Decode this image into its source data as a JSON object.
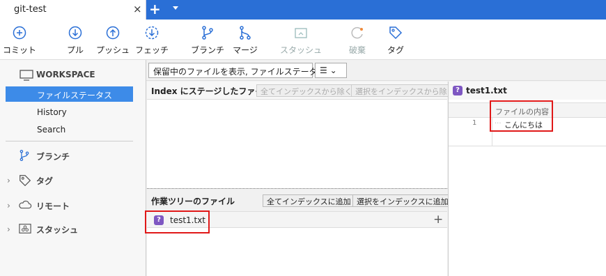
{
  "tab": {
    "title": "git-test",
    "close": "×",
    "new_tab": "+"
  },
  "toolbar": {
    "commit": "コミット",
    "pull": "プル",
    "push": "プッシュ",
    "fetch": "フェッチ",
    "branch": "ブランチ",
    "merge": "マージ",
    "stash": "スタッシュ",
    "discard": "破棄",
    "tag": "タグ"
  },
  "sidebar": {
    "workspace": "WORKSPACE",
    "items": [
      "ファイルステータス",
      "History",
      "Search"
    ],
    "groups": [
      "ブランチ",
      "タグ",
      "リモート",
      "スタッシュ"
    ]
  },
  "filter": {
    "view": "保留中のファイルを表示, ファイルステータス順 ⌄",
    "menu": "☰ ⌄"
  },
  "staged": {
    "title": "Index にステージしたファイル",
    "remove_all": "全てインデックスから除く",
    "remove_sel": "選択をインデックスから除く"
  },
  "working": {
    "title": "作業ツリーのファイル",
    "add_all": "全てインデックスに追加",
    "add_sel": "選択をインデックスに追加",
    "file": "test1.txt",
    "status_icon": "?"
  },
  "diff": {
    "file": "test1.txt",
    "status_icon": "?",
    "header": "ファイルの内容",
    "line_no": "1",
    "dots": "···",
    "line": "こんにちは"
  },
  "colors": {
    "accent": "#2a6fd6",
    "selected": "#3d8be8",
    "highlight": "#e01818",
    "untracked": "#7e57c2"
  }
}
